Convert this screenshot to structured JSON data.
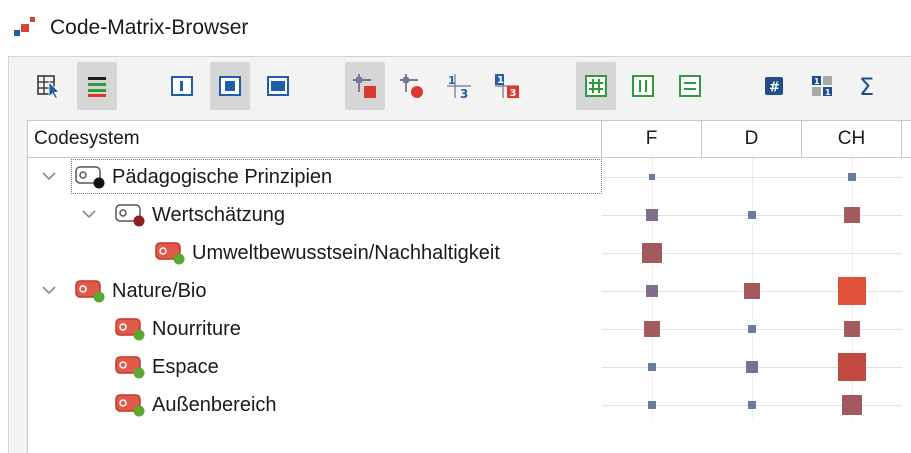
{
  "window": {
    "title": "Code-Matrix-Browser"
  },
  "toolbar": {
    "buttons": [
      {
        "name": "select-codes-button",
        "icon": "select-grid-icon",
        "active": false
      },
      {
        "name": "display-settings-button",
        "icon": "color-lines-icon",
        "active": true
      },
      {
        "name": "view-single-button",
        "icon": "view-single-icon",
        "active": false
      },
      {
        "name": "view-medium-button",
        "icon": "view-medium-icon",
        "active": true
      },
      {
        "name": "view-wide-button",
        "icon": "view-wide-icon",
        "active": false
      },
      {
        "name": "symbol-square-button",
        "icon": "square-node-icon",
        "active": true
      },
      {
        "name": "symbol-circle-button",
        "icon": "circle-node-icon",
        "active": false
      },
      {
        "name": "numbers-button",
        "icon": "numbers-icon",
        "active": false
      },
      {
        "name": "numbers-colored-button",
        "icon": "numbers-colored-icon",
        "active": false
      },
      {
        "name": "grid-all-button",
        "icon": "grid-hash-icon",
        "active": true
      },
      {
        "name": "grid-columns-button",
        "icon": "grid-columns-icon",
        "active": false
      },
      {
        "name": "grid-rows-button",
        "icon": "grid-rows-icon",
        "active": false
      },
      {
        "name": "hash-button",
        "icon": "hash-icon",
        "active": false
      },
      {
        "name": "binary-button",
        "icon": "binary-icon",
        "active": false
      },
      {
        "name": "sum-button",
        "icon": "sigma-icon",
        "active": false
      }
    ]
  },
  "columns": {
    "codesystem": "Codesystem",
    "documents": [
      "F",
      "D",
      "CH"
    ]
  },
  "rows": [
    {
      "label": "Pädagogische Prinzipien",
      "level": 0,
      "expanded": true,
      "icon_badge": "black",
      "cells": [
        "tiny",
        "none",
        "small"
      ]
    },
    {
      "label": "Wertschätzung",
      "level": 1,
      "expanded": true,
      "icon_badge": "darkred",
      "cells": [
        "medium",
        "small",
        "large"
      ]
    },
    {
      "label": "Umweltbewusstsein/Nachhaltigkeit",
      "level": 2,
      "expanded": false,
      "icon_badge": "green",
      "cells": [
        "xlarge",
        "none",
        "none"
      ]
    },
    {
      "label": "Nature/Bio",
      "level": 0,
      "expanded": true,
      "icon_badge": "green",
      "cells": [
        "medium",
        "large",
        "xxlarge-red"
      ]
    },
    {
      "label": "Nourriture",
      "level": 1,
      "expanded": false,
      "icon_badge": "green",
      "cells": [
        "large",
        "small",
        "large"
      ]
    },
    {
      "label": "Espace",
      "level": 1,
      "expanded": false,
      "icon_badge": "green",
      "cells": [
        "small",
        "medium",
        "xxlarge-darkred"
      ]
    },
    {
      "label": "Außenbereich",
      "level": 1,
      "expanded": false,
      "icon_badge": "green",
      "cells": [
        "small",
        "small",
        "xlarge"
      ]
    }
  ],
  "colors": {
    "square_mauve": "#7f6e8c",
    "square_slate": "#6a7ba0",
    "square_rose": "#a25a5e",
    "square_red": "#e0513a",
    "square_brick": "#c04a3f",
    "accent_blue": "#1f5fa8",
    "accent_green": "#3a9a3a"
  }
}
